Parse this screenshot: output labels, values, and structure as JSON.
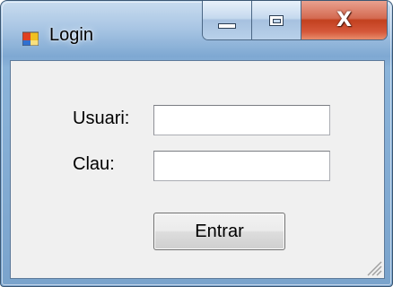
{
  "window": {
    "title": "Login",
    "caption": {
      "minimize_icon": "minimize-icon",
      "maximize_icon": "maximize-icon",
      "close_glyph": "X"
    }
  },
  "form": {
    "username_label": "Usuari:",
    "username_value": "",
    "password_label": "Clau:",
    "password_value": "",
    "submit_label": "Entrar"
  },
  "colors": {
    "frame": "#7ea8d2",
    "client": "#f0f0f0",
    "close_button": "#c2401f"
  }
}
